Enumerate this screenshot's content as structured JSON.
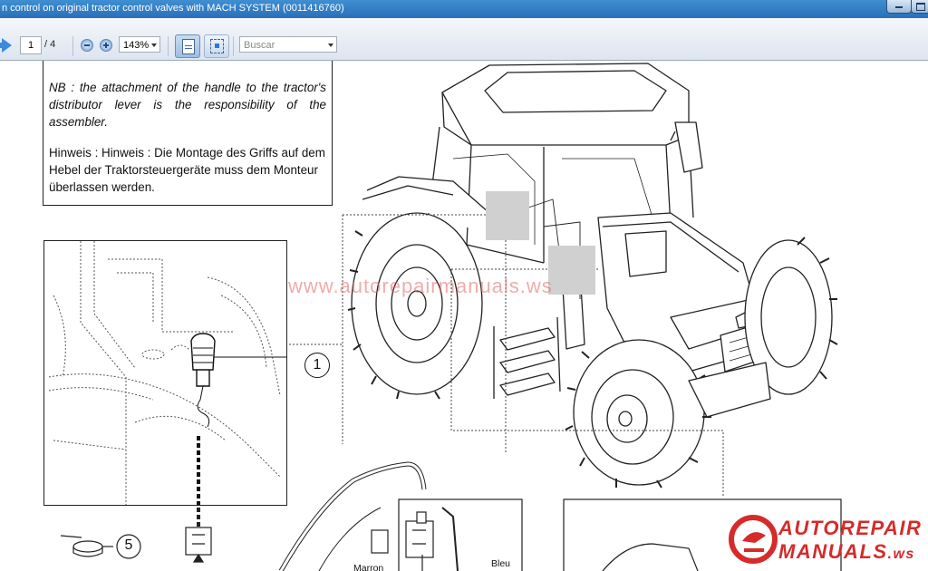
{
  "window": {
    "title": "n control on original tractor control valves with MACH SYSTEM (0011416760)"
  },
  "toolbar": {
    "page_current": "1",
    "page_total": "/ 4",
    "zoom": "143%",
    "search_placeholder": "Buscar"
  },
  "document": {
    "note_en": "NB : the attachment of the handle to the tractor's distributor lever is the responsibility of the assembler.",
    "note_de": "Hinweis : Hinweis : Die Montage des Griffs auf dem Hebel der Traktorsteuergeräte muss dem Monteur überlassen werden.",
    "callout_1": "1",
    "callout_5": "5",
    "label_marron": "Marron",
    "label_bleu": "Bleu",
    "watermark": "www.autorepairmanuals.ws"
  },
  "logo": {
    "line1": "AUTOREPAIR",
    "line2": "MANUALS",
    "suffix": ".ws",
    "color": "#d52b2b"
  },
  "icons": {
    "forward": "arrow-right-icon",
    "zoom_out": "zoom-out-icon",
    "zoom_in": "zoom-in-icon",
    "single_page": "single-page-view-icon",
    "fit": "fit-page-icon",
    "window_min": "minimize-icon",
    "window_max": "maximize-icon"
  }
}
